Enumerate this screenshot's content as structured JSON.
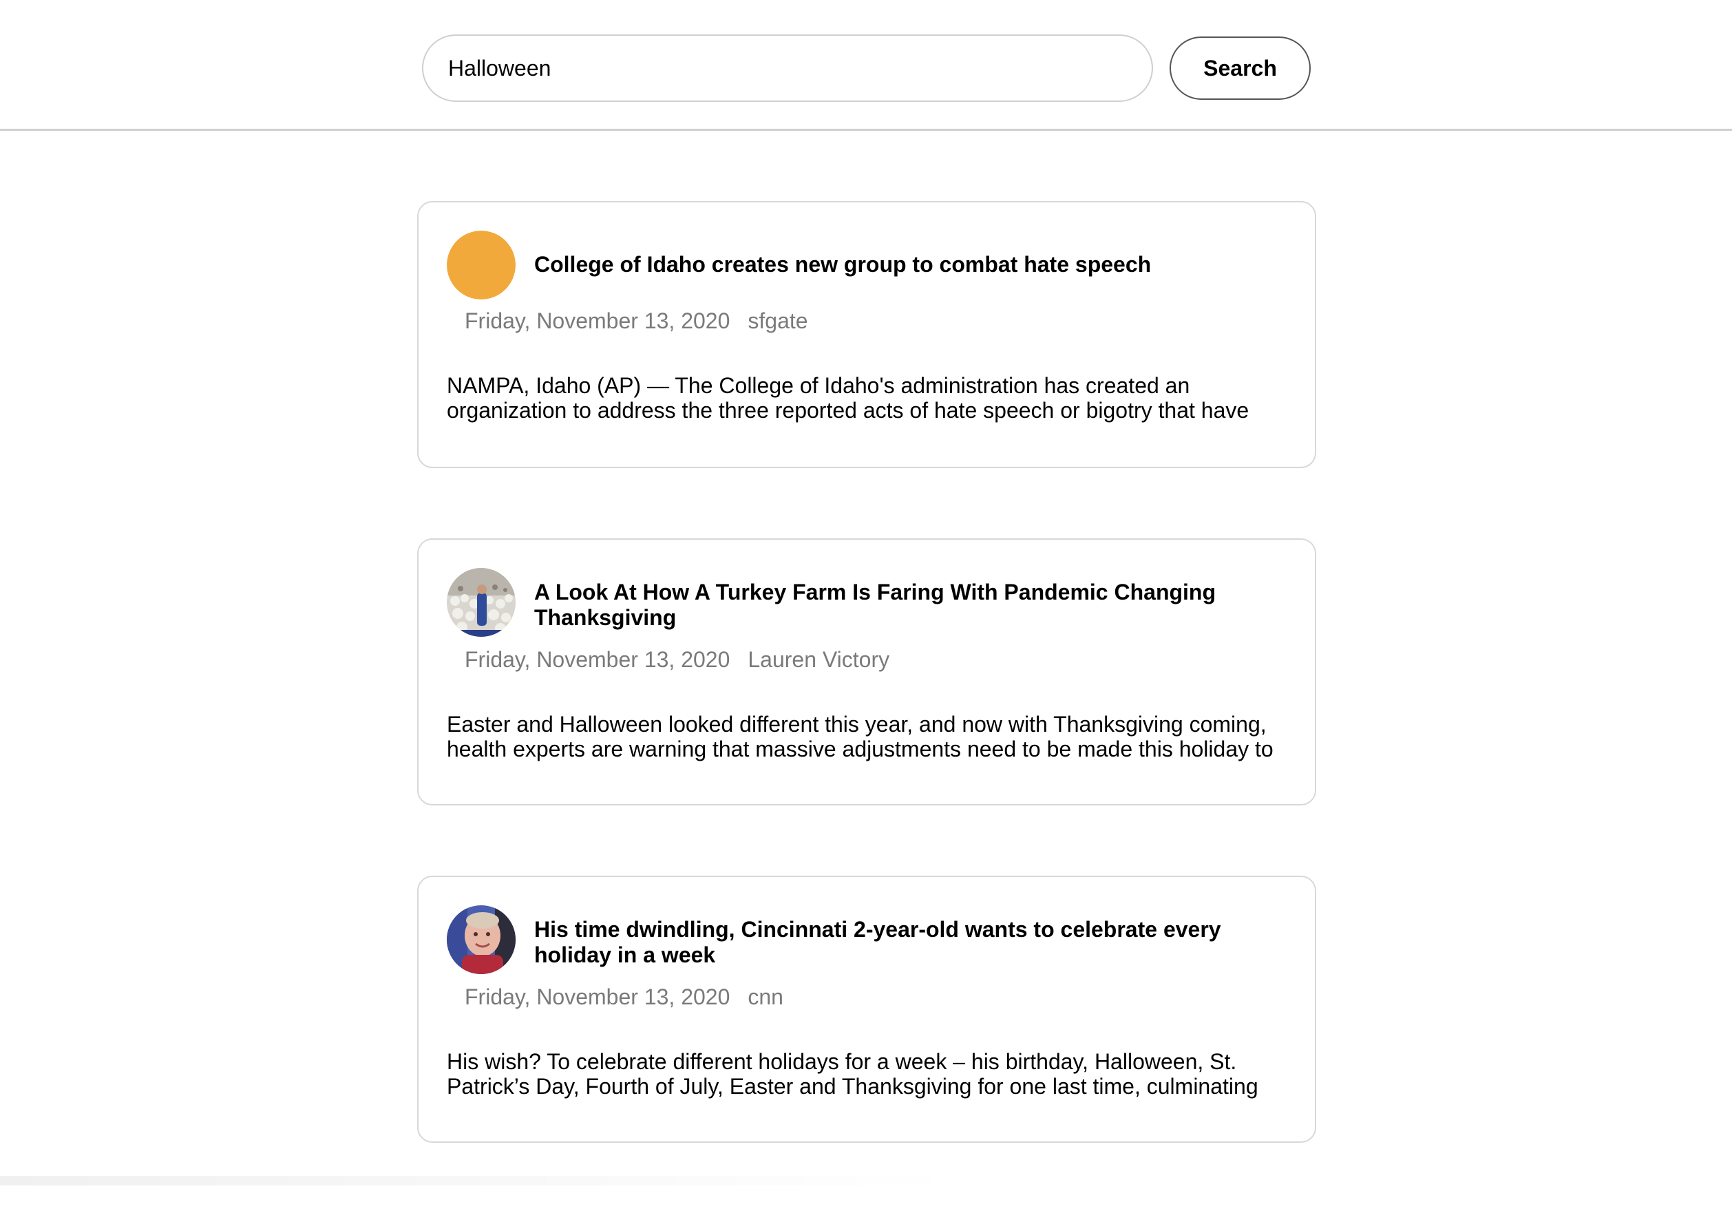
{
  "search": {
    "query": "Halloween",
    "button_label": "Search"
  },
  "results": [
    {
      "avatar": "orange-circle",
      "avatar_color": "#F2A93B",
      "title": "College of Idaho creates new group to combat hate speech",
      "date": "Friday, November 13, 2020",
      "source": "sfgate",
      "snippet": "NAMPA, Idaho (AP) — The College of Idaho's administration has created an organization to address the three reported acts of hate speech or bigotry that have"
    },
    {
      "avatar": "turkey-farm-thumbnail",
      "title": "A Look At How A Turkey Farm Is Faring With Pandemic Changing Thanksgiving",
      "date": "Friday, November 13, 2020",
      "source": "Lauren Victory",
      "snippet": "Easter and Halloween looked different this year, and now with Thanksgiving coming, health experts are warning that massive adjustments need to be made this holiday to"
    },
    {
      "avatar": "child-portrait-thumbnail",
      "title": "His time dwindling, Cincinnati 2-year-old wants to celebrate every holiday in a week",
      "date": "Friday, November 13, 2020",
      "source": "cnn",
      "snippet": "His wish? To celebrate different holidays for a week – his birthday, Halloween, St. Patrick’s Day, Fourth of July, Easter and Thanksgiving for one last time, culminating"
    }
  ]
}
